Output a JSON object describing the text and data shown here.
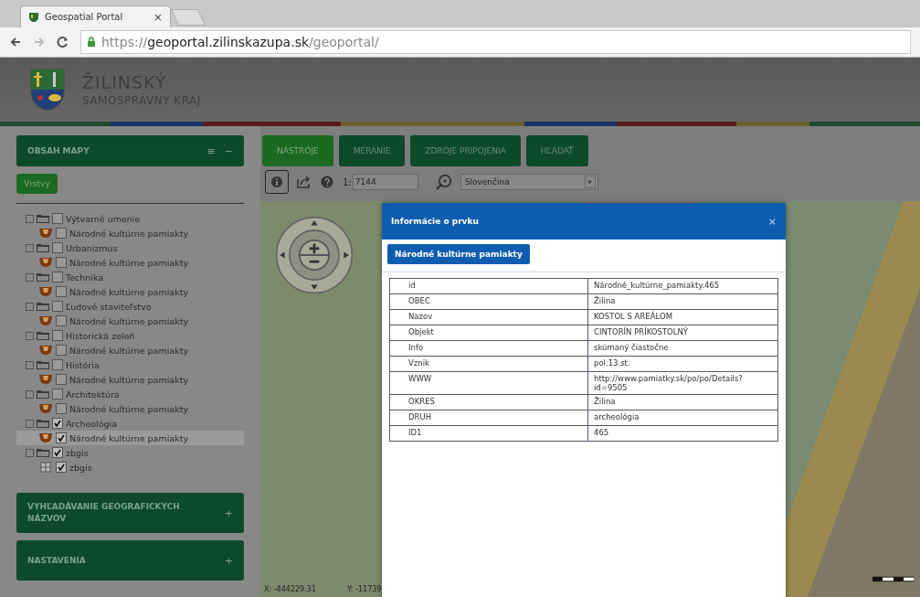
{
  "browser": {
    "tab_title": "Geospatial Portal",
    "tab_close": "×",
    "url": "https://**geoportal.zilinskazupa.sk**/geoportal/"
  },
  "header": {
    "title": "ŽILINSKÝ",
    "subtitle": "SAMOSPRÁVNY KRAJ"
  },
  "sidebar": {
    "panel_title": "OBSAH MAPY",
    "panel_icons": [
      "≡",
      "−"
    ],
    "layers_button": "Vrstvy",
    "layers": [
      {
        "label": "Výtvarné umenie",
        "checked": false,
        "children": [
          {
            "label": "Národné kultúrne pamiakty",
            "kind": "monument",
            "checked": false,
            "selected": false
          }
        ]
      },
      {
        "label": "Urbanizmus",
        "checked": false,
        "children": [
          {
            "label": "Národné kultúrne pamiakty",
            "kind": "monument",
            "checked": false,
            "selected": false
          }
        ]
      },
      {
        "label": "Technika",
        "checked": false,
        "children": [
          {
            "label": "Národné kultúrne pamiakty",
            "kind": "monument",
            "checked": false,
            "selected": false
          }
        ]
      },
      {
        "label": "Ľudové staviteľstvo",
        "checked": false,
        "children": [
          {
            "label": "Národné kultúrne pamiakty",
            "kind": "monument",
            "checked": false,
            "selected": false
          }
        ]
      },
      {
        "label": "Historická zeleň",
        "checked": false,
        "children": [
          {
            "label": "Národné kultúrne pamiakty",
            "kind": "monument",
            "checked": false,
            "selected": false
          }
        ]
      },
      {
        "label": "História",
        "checked": false,
        "children": [
          {
            "label": "Národné kultúrne pamiakty",
            "kind": "monument",
            "checked": false,
            "selected": false
          }
        ]
      },
      {
        "label": "Architektúra",
        "checked": false,
        "children": [
          {
            "label": "Národné kultúrne pamiakty",
            "kind": "monument",
            "checked": false,
            "selected": false
          }
        ]
      },
      {
        "label": "Archeológia",
        "checked": true,
        "children": [
          {
            "label": "Národné kultúrne pamiakty",
            "kind": "monument",
            "checked": true,
            "selected": true
          }
        ]
      },
      {
        "label": "zbgis",
        "checked": true,
        "children": [
          {
            "label": "zbgis",
            "kind": "grid",
            "checked": true,
            "selected": false
          }
        ]
      }
    ],
    "panels": [
      {
        "title": "VYHĽADÁVANIE GEOGRAFICKÝCH NÁZVOV",
        "icon": "+"
      },
      {
        "title": "NASTAVENIA",
        "icon": "+"
      }
    ]
  },
  "toolbar": {
    "tabs": [
      {
        "label": "NÁSTROJE",
        "selected": true
      },
      {
        "label": "MERANIE",
        "selected": false
      },
      {
        "label": "ZDROJE PRIPOJENIA",
        "selected": false
      },
      {
        "label": "HĽADAŤ",
        "selected": false
      }
    ],
    "scale_prefix": "1:",
    "scale_value": "7144",
    "language": "Slovenčina"
  },
  "map": {
    "x_coord": "X: -444229.31",
    "y_coord": "Y: -11739"
  },
  "dialog": {
    "title": "Informácie o prvku",
    "close": "×",
    "layer_tab": "Národné kultúrne pamiakty",
    "rows": [
      {
        "key": "id",
        "value": "Národné_kultúrne_pamiakty.465"
      },
      {
        "key": "OBEC",
        "value": "Žilina"
      },
      {
        "key": "Nazov",
        "value": "KOSTOL S AREÁLOM"
      },
      {
        "key": "Objekt",
        "value": "CINTORÍN PRÍKOSTOLNÝ"
      },
      {
        "key": "Info",
        "value": "skúmaný čiastočne"
      },
      {
        "key": "Vznik",
        "value": "pol.13.st."
      },
      {
        "key": "WWW",
        "value": "http://www.pamiatky.sk/po/po/Details?id=9505"
      },
      {
        "key": "OKRES",
        "value": "Žilina"
      },
      {
        "key": "DRUH",
        "value": "archeológia"
      },
      {
        "key": "ID1",
        "value": "465"
      }
    ]
  }
}
